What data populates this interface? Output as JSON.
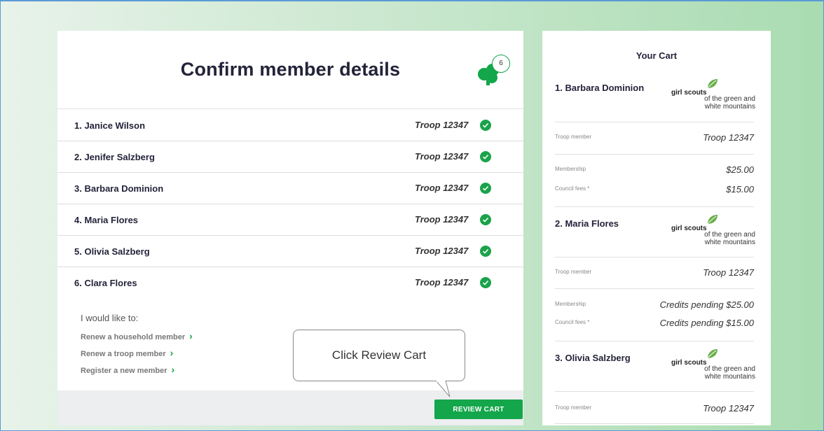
{
  "page": {
    "title": "Confirm member details",
    "badge_count": "6"
  },
  "members": [
    {
      "name": "1. Janice Wilson",
      "troop": "Troop 12347"
    },
    {
      "name": "2. Jenifer Salzberg",
      "troop": "Troop 12347"
    },
    {
      "name": "3. Barbara Dominion",
      "troop": "Troop 12347"
    },
    {
      "name": "4. Maria Flores",
      "troop": "Troop 12347"
    },
    {
      "name": "5. Olivia Salzberg",
      "troop": "Troop 12347"
    },
    {
      "name": "6. Clara Flores",
      "troop": "Troop 12347"
    }
  ],
  "options": {
    "label": "I would like to:",
    "links": [
      "Renew a household member",
      "Renew a troop member",
      "Register a new member"
    ]
  },
  "callout": {
    "text": "Click Review Cart"
  },
  "review_button": {
    "label": "REVIEW CART"
  },
  "cart": {
    "title": "Your Cart",
    "logo": {
      "line1": "girl scouts",
      "line2": "of the green and",
      "line3": "white mountains"
    },
    "entries": [
      {
        "name": "1. Barbara Dominion",
        "troop_label": "Troop member",
        "troop_value": "Troop 12347",
        "membership_label": "Membership",
        "membership_value": "$25.00",
        "council_label": "Council fees *",
        "council_value": "$15.00"
      },
      {
        "name": "2. Maria Flores",
        "troop_label": "Troop member",
        "troop_value": "Troop 12347",
        "membership_label": "Membership",
        "membership_value": "Credits pending $25.00",
        "council_label": "Council fees *",
        "council_value": "Credits pending $15.00"
      },
      {
        "name": "3. Olivia Salzberg",
        "troop_label": "Troop member",
        "troop_value": "Troop 12347"
      }
    ]
  },
  "colors": {
    "brand_green": "#13a64a",
    "title_navy": "#23233a"
  },
  "icons": {
    "check": "check-circle-icon",
    "chevron": "chevron-right-icon",
    "trefoil": "trefoil-icon",
    "leaf": "leaf-logo-icon"
  }
}
